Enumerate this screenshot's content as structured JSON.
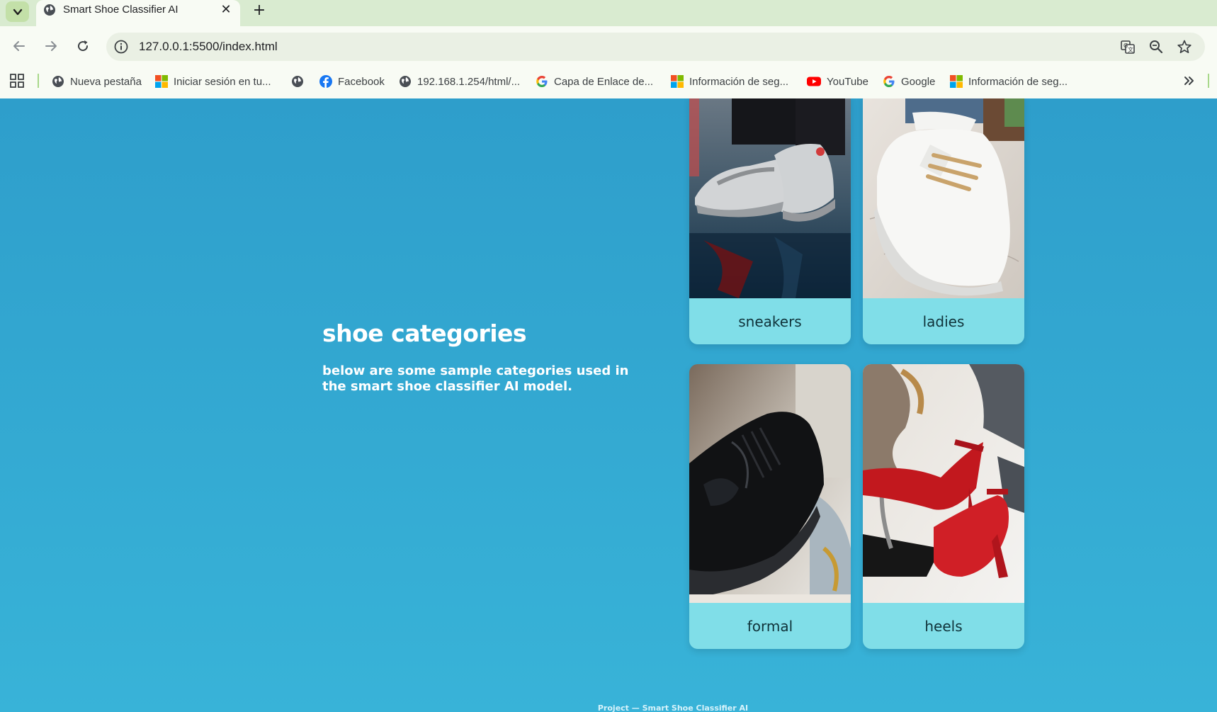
{
  "browser": {
    "tab": {
      "title": "Smart Shoe Classifier AI",
      "close": "✕"
    },
    "new_tab": "+",
    "url": "127.0.0.1:5500/index.html",
    "bookmarks": [
      {
        "label": "Nueva pestaña",
        "icon": "globe-icon"
      },
      {
        "label": "Iniciar sesión en tu...",
        "icon": "microsoft-icon"
      },
      {
        "label": "",
        "icon": "globe-icon"
      },
      {
        "label": "Facebook",
        "icon": "facebook-icon"
      },
      {
        "label": "192.168.1.254/html/...",
        "icon": "globe-icon"
      },
      {
        "label": "Capa de Enlace de...",
        "icon": "google-icon"
      },
      {
        "label": "Información de seg...",
        "icon": "microsoft-icon"
      },
      {
        "label": "YouTube",
        "icon": "youtube-icon"
      },
      {
        "label": "Google",
        "icon": "google-icon"
      },
      {
        "label": "Información de seg...",
        "icon": "microsoft-icon"
      }
    ]
  },
  "page": {
    "title": "shoe categories",
    "subtitle": "below are some sample categories used in the smart shoe classifier AI model.",
    "categories": [
      {
        "label": "sneakers"
      },
      {
        "label": "ladies"
      },
      {
        "label": "formal"
      },
      {
        "label": "heels"
      }
    ],
    "footer": "Project — Smart Shoe Classifier AI"
  },
  "colors": {
    "page_background": "#2e9ecb",
    "card_label_background": "#80dee8",
    "tab_strip": "#d9ebd0"
  }
}
